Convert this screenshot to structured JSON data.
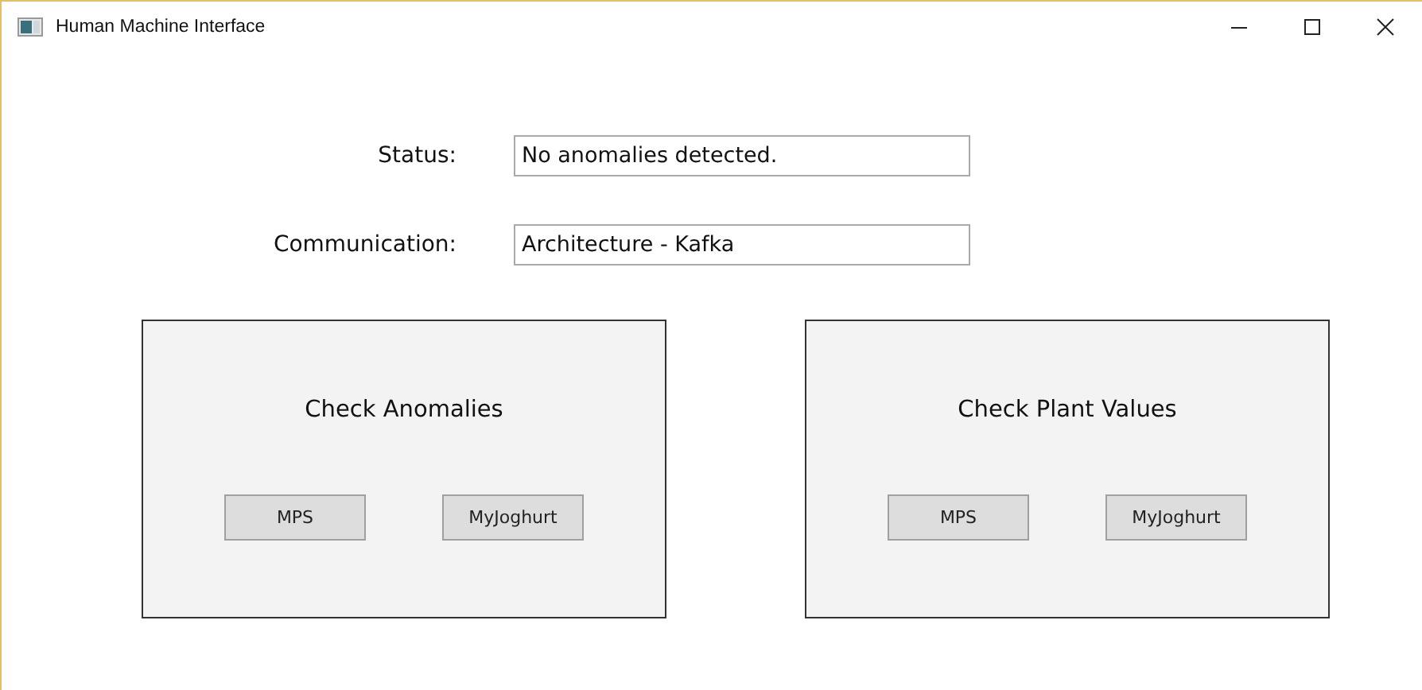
{
  "window": {
    "title": "Human Machine Interface"
  },
  "fields": [
    {
      "label": "Status:",
      "value": "No anomalies detected."
    },
    {
      "label": "Communication:",
      "value": "Architecture - Kafka"
    }
  ],
  "panels": [
    {
      "title": "Check Anomalies",
      "buttons": [
        "MPS",
        "MyJoghurt"
      ]
    },
    {
      "title": "Check Plant Values",
      "buttons": [
        "MPS",
        "MyJoghurt"
      ]
    }
  ]
}
